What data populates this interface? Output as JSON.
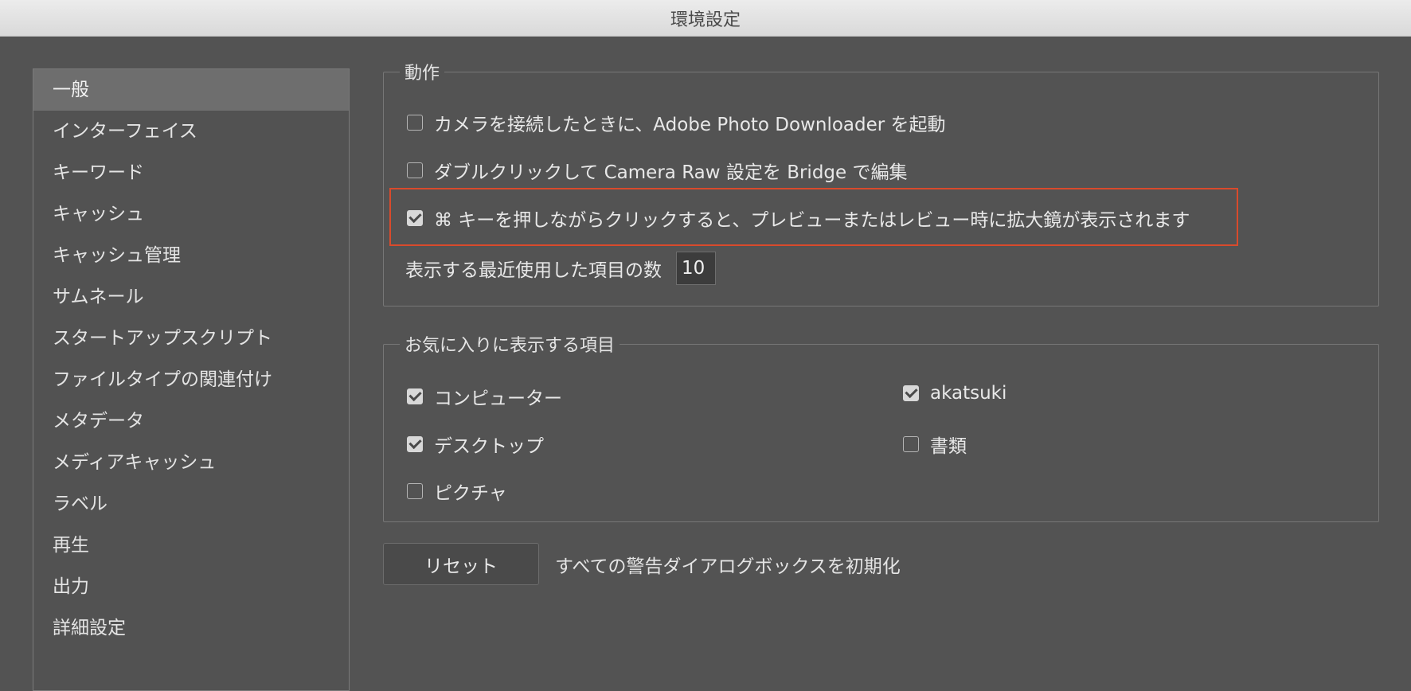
{
  "window": {
    "title": "環境設定"
  },
  "sidebar": {
    "items": [
      {
        "label": "一般",
        "selected": true
      },
      {
        "label": "インターフェイス"
      },
      {
        "label": "キーワード"
      },
      {
        "label": "キャッシュ"
      },
      {
        "label": "キャッシュ管理"
      },
      {
        "label": "サムネール"
      },
      {
        "label": "スタートアップスクリプト"
      },
      {
        "label": "ファイルタイプの関連付け"
      },
      {
        "label": "メタデータ"
      },
      {
        "label": "メディアキャッシュ"
      },
      {
        "label": "ラベル"
      },
      {
        "label": "再生"
      },
      {
        "label": "出力"
      },
      {
        "label": "詳細設定"
      }
    ]
  },
  "behavior": {
    "legend": "動作",
    "options": [
      {
        "label": "カメラを接続したときに、Adobe Photo Downloader を起動",
        "checked": false
      },
      {
        "label": "ダブルクリックして Camera Raw 設定を Bridge で編集",
        "checked": false
      },
      {
        "label": "⌘ キーを押しながらクリックすると、プレビューまたはレビュー時に拡大鏡が表示されます",
        "checked": true
      }
    ],
    "recent_label": "表示する最近使用した項目の数",
    "recent_value": "10"
  },
  "favorites": {
    "legend": "お気に入りに表示する項目",
    "items": [
      {
        "label": "コンピューター",
        "checked": true
      },
      {
        "label": "デスクトップ",
        "checked": true
      },
      {
        "label": "ピクチャ",
        "checked": false
      },
      {
        "label": "akatsuki",
        "checked": true
      },
      {
        "label": "書類",
        "checked": false
      }
    ]
  },
  "reset": {
    "button_label": "リセット",
    "description": "すべての警告ダイアログボックスを初期化"
  },
  "colors": {
    "background": "#535353",
    "highlight_border": "#d94a2c"
  }
}
